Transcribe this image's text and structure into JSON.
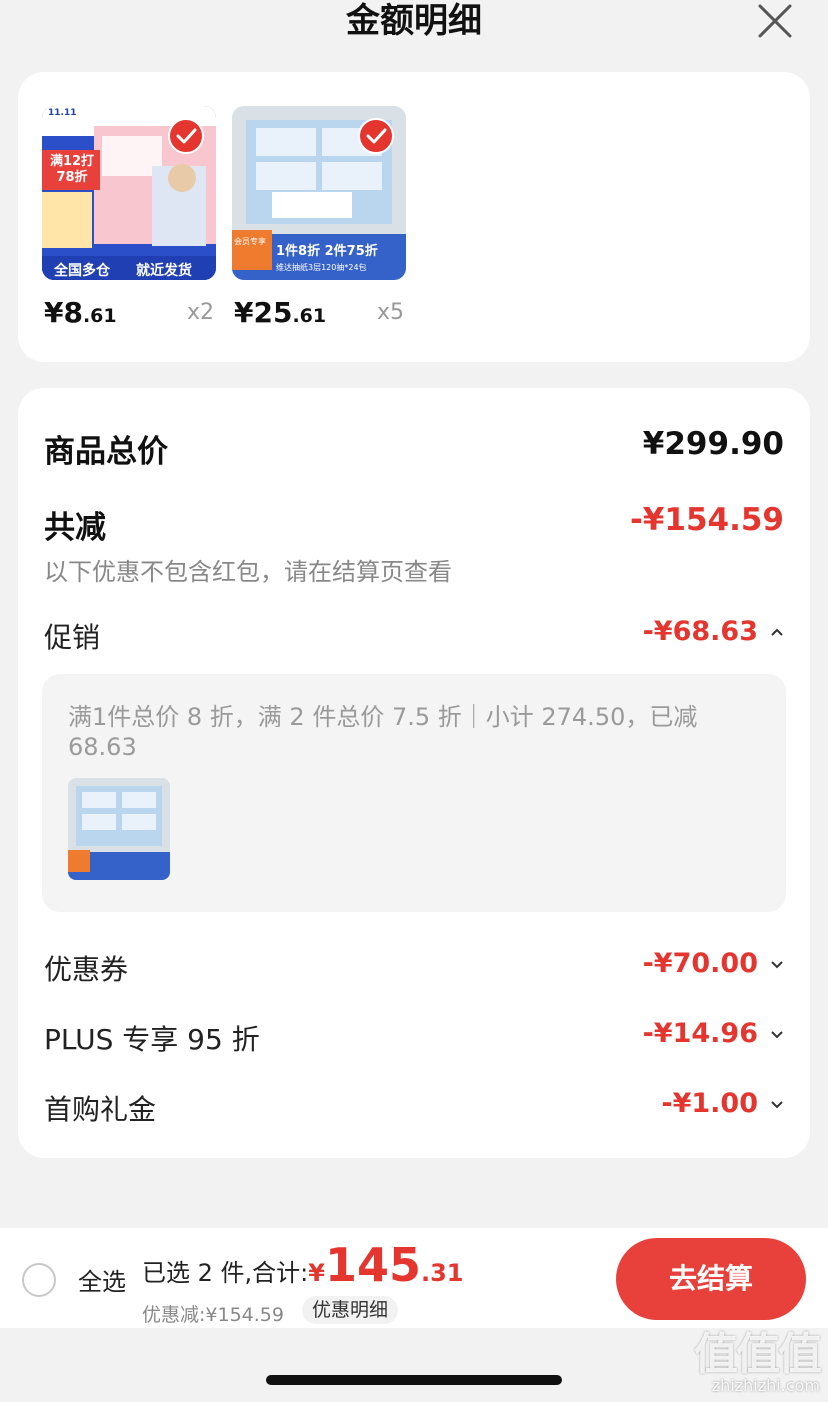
{
  "header": {
    "title": "金额明细"
  },
  "products": [
    {
      "price_int": "¥8",
      "price_dec": ".61",
      "qty": "x2",
      "thumb": {
        "tag": "11.11",
        "badge": "满12打78折",
        "footer_left": "全国多仓",
        "footer_right": "就近发货"
      }
    },
    {
      "price_int": "¥25",
      "price_dec": ".61",
      "qty": "x5",
      "thumb": {
        "member": "会员专享",
        "offer": "1件8折 2件75折",
        "caption": "维达抽纸3层120抽*24包"
      }
    }
  ],
  "details": {
    "total_label": "商品总价",
    "total_value": "¥299.90",
    "reduce_label": "共减",
    "reduce_value": "-¥154.59",
    "note": "以下优惠不包含红包，请在结算页查看",
    "promo_label": "促销",
    "promo_value": "-¥68.63",
    "promo_text": "满1件总价 8 折，满 2 件总价 7.5 折｜小计 274.50，已减 68.63",
    "coupon_label": "优惠券",
    "coupon_value": "-¥70.00",
    "plus_label": "PLUS 专享 95 折",
    "plus_value": "-¥14.96",
    "gift_label": "首购礼金",
    "gift_value": "-¥1.00"
  },
  "bottom": {
    "select_all": "全选",
    "summary_label": "已选 2 件,合计:",
    "summary_yen": "¥",
    "summary_int": "145",
    "summary_dec": ".31",
    "discount_line": "优惠减:¥154.59",
    "detail_link": "优惠明细",
    "checkout": "去结算"
  },
  "watermark": {
    "text": "值值值",
    "url": "zhizhizhi.com"
  },
  "colors": {
    "accent_red": "#e5352f",
    "button_red": "#e8413c",
    "background": "#f2f2f2"
  }
}
